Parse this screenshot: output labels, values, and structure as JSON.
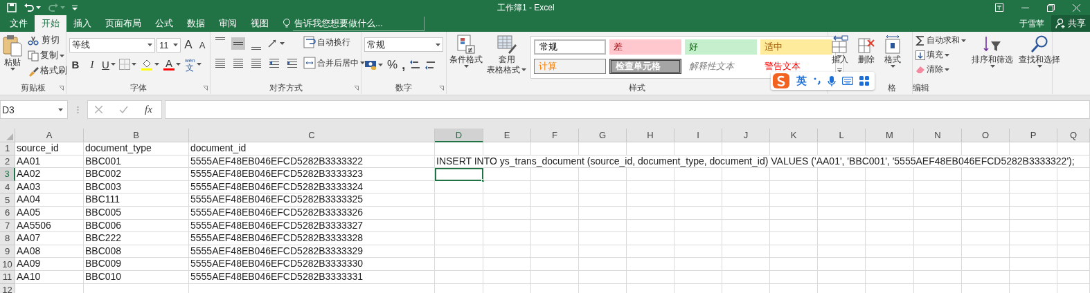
{
  "window": {
    "title": "工作簿1 - Excel"
  },
  "tabs": [
    {
      "label": "文件",
      "selected": false
    },
    {
      "label": "开始",
      "selected": true
    },
    {
      "label": "插入",
      "selected": false
    },
    {
      "label": "页面布局",
      "selected": false
    },
    {
      "label": "公式",
      "selected": false
    },
    {
      "label": "数据",
      "selected": false
    },
    {
      "label": "审阅",
      "selected": false
    },
    {
      "label": "视图",
      "selected": false
    }
  ],
  "tell_me": {
    "placeholder": "告诉我您想要做什么..."
  },
  "account": {
    "user": "于雪苹",
    "share": "共享"
  },
  "ribbon": {
    "clipboard": {
      "label": "剪贴板",
      "paste": "粘贴",
      "cut": "剪切",
      "copy": "复制",
      "format_painter": "格式刷"
    },
    "font": {
      "label": "字体",
      "font_name": "等线",
      "font_size": "11",
      "grow": "A",
      "shrink": "A",
      "bold": "B",
      "italic": "I",
      "underline": "U",
      "font_color": "A",
      "phonetic_top": "wén",
      "phonetic": "文"
    },
    "alignment": {
      "label": "对齐方式",
      "wrap_text": "自动换行",
      "merge_center": "合并后居中"
    },
    "number": {
      "label": "数字",
      "format": "常规",
      "percent": "%",
      "comma": ","
    },
    "styles": {
      "label": "样式",
      "conditional": "条件格式",
      "table_line1": "套用",
      "table_line2": "表格格式",
      "gallery": [
        {
          "label": "常规",
          "kind": "normal"
        },
        {
          "label": "差",
          "kind": "bad"
        },
        {
          "label": "好",
          "kind": "good"
        },
        {
          "label": "适中",
          "kind": "neutral"
        },
        {
          "label": "计算",
          "kind": "calc"
        },
        {
          "label": "检查单元格",
          "kind": "check"
        },
        {
          "label": "解释性文本",
          "kind": "explanatory"
        },
        {
          "label": "警告文本",
          "kind": "warning"
        }
      ]
    },
    "cells": {
      "label": "格",
      "insert": "插入",
      "delete": "删除",
      "format": "格式"
    },
    "editing": {
      "label": "编辑",
      "autosum": "自动求和",
      "fill": "填充",
      "clear": "清除",
      "sort_filter": "排序和筛选",
      "find_select": "查找和选择"
    }
  },
  "formula_bar": {
    "name_box": "D3",
    "fx": "fx"
  },
  "sheet": {
    "columns": [
      {
        "label": "A",
        "selected": false
      },
      {
        "label": "B",
        "selected": false
      },
      {
        "label": "C",
        "selected": false
      },
      {
        "label": "D",
        "selected": true
      },
      {
        "label": "E",
        "selected": false
      },
      {
        "label": "F",
        "selected": false
      },
      {
        "label": "G",
        "selected": false
      },
      {
        "label": "H",
        "selected": false
      },
      {
        "label": "I",
        "selected": false
      },
      {
        "label": "J",
        "selected": false
      },
      {
        "label": "K",
        "selected": false
      },
      {
        "label": "L",
        "selected": false
      },
      {
        "label": "M",
        "selected": false
      },
      {
        "label": "N",
        "selected": false
      },
      {
        "label": "O",
        "selected": false
      },
      {
        "label": "P",
        "selected": false
      },
      {
        "label": "Q",
        "selected": false
      }
    ],
    "rows": [
      {
        "number": "1",
        "selected": false,
        "cells": [
          "source_id",
          "document_type",
          "document_id"
        ]
      },
      {
        "number": "2",
        "selected": false,
        "cells": [
          "AA01",
          "BBC001",
          "5555AEF48EB046EFCD5282B3333322",
          "INSERT INTO ys_trans_document (source_id, document_type, document_id) VALUES ('AA01', 'BBC001', '5555AEF48EB046EFCD5282B3333322');"
        ]
      },
      {
        "number": "3",
        "selected": true,
        "cells": [
          "AA02",
          "BBC002",
          "5555AEF48EB046EFCD5282B3333323"
        ]
      },
      {
        "number": "4",
        "selected": false,
        "cells": [
          "AA03",
          "BBC003",
          "5555AEF48EB046EFCD5282B3333324"
        ]
      },
      {
        "number": "5",
        "selected": false,
        "cells": [
          "AA04",
          "BBC111",
          "5555AEF48EB046EFCD5282B3333325"
        ]
      },
      {
        "number": "6",
        "selected": false,
        "cells": [
          "AA05",
          "BBC005",
          "5555AEF48EB046EFCD5282B3333326"
        ]
      },
      {
        "number": "7",
        "selected": false,
        "cells": [
          "AA5506",
          "BBC006",
          "5555AEF48EB046EFCD5282B3333327"
        ]
      },
      {
        "number": "8",
        "selected": false,
        "cells": [
          "AA07",
          "BBC222",
          "5555AEF48EB046EFCD5282B3333328"
        ]
      },
      {
        "number": "9",
        "selected": false,
        "cells": [
          "AA08",
          "BBC008",
          "5555AEF48EB046EFCD5282B3333329"
        ]
      },
      {
        "number": "10",
        "selected": false,
        "cells": [
          "AA09",
          "BBC009",
          "5555AEF48EB046EFCD5282B3333330"
        ]
      },
      {
        "number": "11",
        "selected": false,
        "cells": [
          "AA10",
          "BBC010",
          "5555AEF48EB046EFCD5282B3333331"
        ]
      },
      {
        "number": "12",
        "selected": false
      }
    ]
  },
  "ime": {
    "mode": "英"
  }
}
